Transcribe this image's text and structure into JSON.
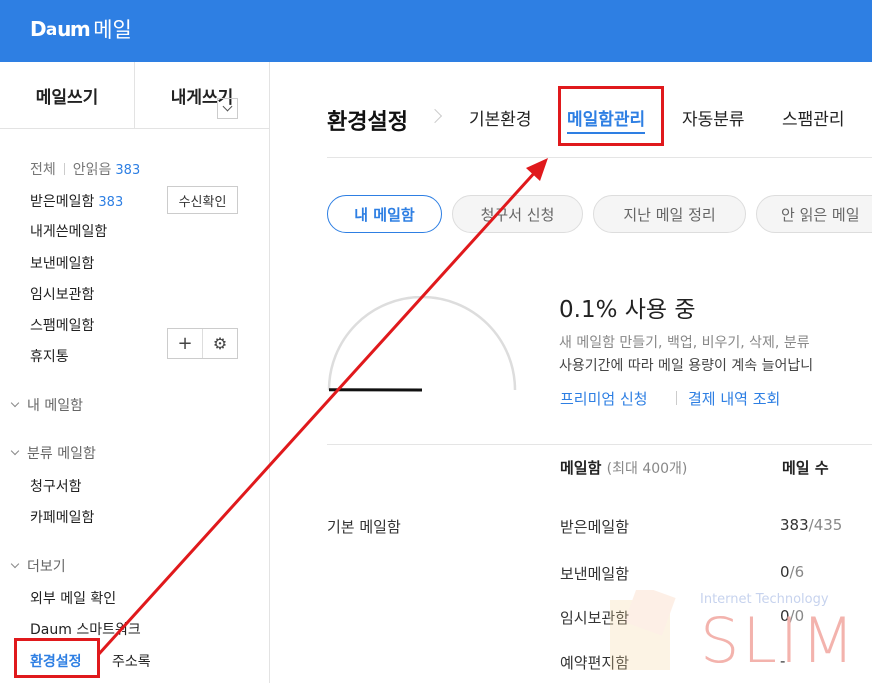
{
  "header": {
    "brand": "Daum",
    "service": "메일"
  },
  "sidebar": {
    "compose_label": "메일쓰기",
    "self_mail_label": "내게쓰기",
    "filter": {
      "all": "전체",
      "unread": "안읽음",
      "unread_count": "383"
    },
    "folders": [
      {
        "label": "받은메일함",
        "count": "383"
      },
      {
        "label": "내게쓴메일함"
      },
      {
        "label": "보낸메일함"
      },
      {
        "label": "임시보관함"
      },
      {
        "label": "스팸메일함"
      },
      {
        "label": "휴지통"
      }
    ],
    "receipt_check_label": "수신확인",
    "my_mailbox_label": "내 메일함",
    "category_label": "분류 메일함",
    "category_items": [
      "청구서함",
      "카페메일함"
    ],
    "more_label": "더보기",
    "more_items": [
      "외부 메일 확인",
      "Daum 스마트워크"
    ],
    "settings_label": "환경설정",
    "addressbook_label": "주소록"
  },
  "main": {
    "title": "환경설정",
    "tabs": [
      "기본환경",
      "메일함관리",
      "자동분류",
      "스팸관리"
    ],
    "active_tab": "메일함관리",
    "pills": [
      "내 메일함",
      "청구서 신청",
      "지난 메일 정리",
      "안 읽은 메일"
    ],
    "usage_text": "0.1% 사용 중",
    "usage_percent": 0.1,
    "desc_line1": "새 메일함 만들기, 백업, 비우기, 삭제, 분류",
    "desc_line2": "사용기간에 따라 메일 용량이 계속 늘어납니",
    "premium_link": "프리미엄 신청",
    "payment_link": "결제 내역 조회",
    "table": {
      "header_mailbox": "메일함",
      "header_mailbox_sub": "(최대 400개)",
      "header_count": "메일 수",
      "group_label": "기본 메일함",
      "rows": [
        {
          "name": "받은메일함",
          "count": "383",
          "total": "/435"
        },
        {
          "name": "보낸메일함",
          "count": "0",
          "total": "/6"
        },
        {
          "name": "임시보관함",
          "count": "0",
          "total": "/0"
        },
        {
          "name": "예약편지함",
          "count": "-",
          "total": ""
        }
      ]
    }
  },
  "watermark": {
    "small_text": "Internet Technology",
    "big_text": "SLIM"
  },
  "colors": {
    "brand_blue": "#2e7fe3",
    "annotation_red": "#e0191c"
  }
}
